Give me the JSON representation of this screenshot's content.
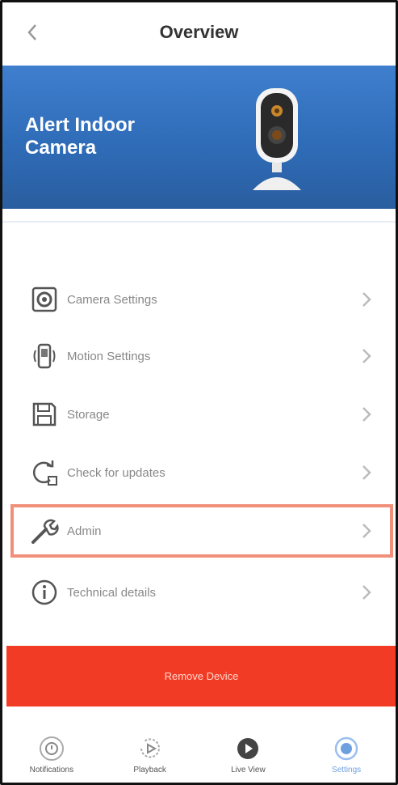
{
  "header": {
    "title": "Overview"
  },
  "banner": {
    "device_name": "Alert Indoor Camera"
  },
  "menu": {
    "items": [
      {
        "label": "Camera Settings"
      },
      {
        "label": "Motion Settings"
      },
      {
        "label": "Storage"
      },
      {
        "label": "Check for updates"
      },
      {
        "label": "Admin"
      },
      {
        "label": "Technical details"
      }
    ]
  },
  "remove_button": {
    "label": "Remove Device"
  },
  "tabbar": {
    "tabs": [
      {
        "label": "Notifications"
      },
      {
        "label": "Playback"
      },
      {
        "label": "Live View"
      },
      {
        "label": "Settings"
      }
    ]
  },
  "colors": {
    "accent": "#3f7fce",
    "danger": "#f23b24",
    "highlight": "#f0907a"
  }
}
